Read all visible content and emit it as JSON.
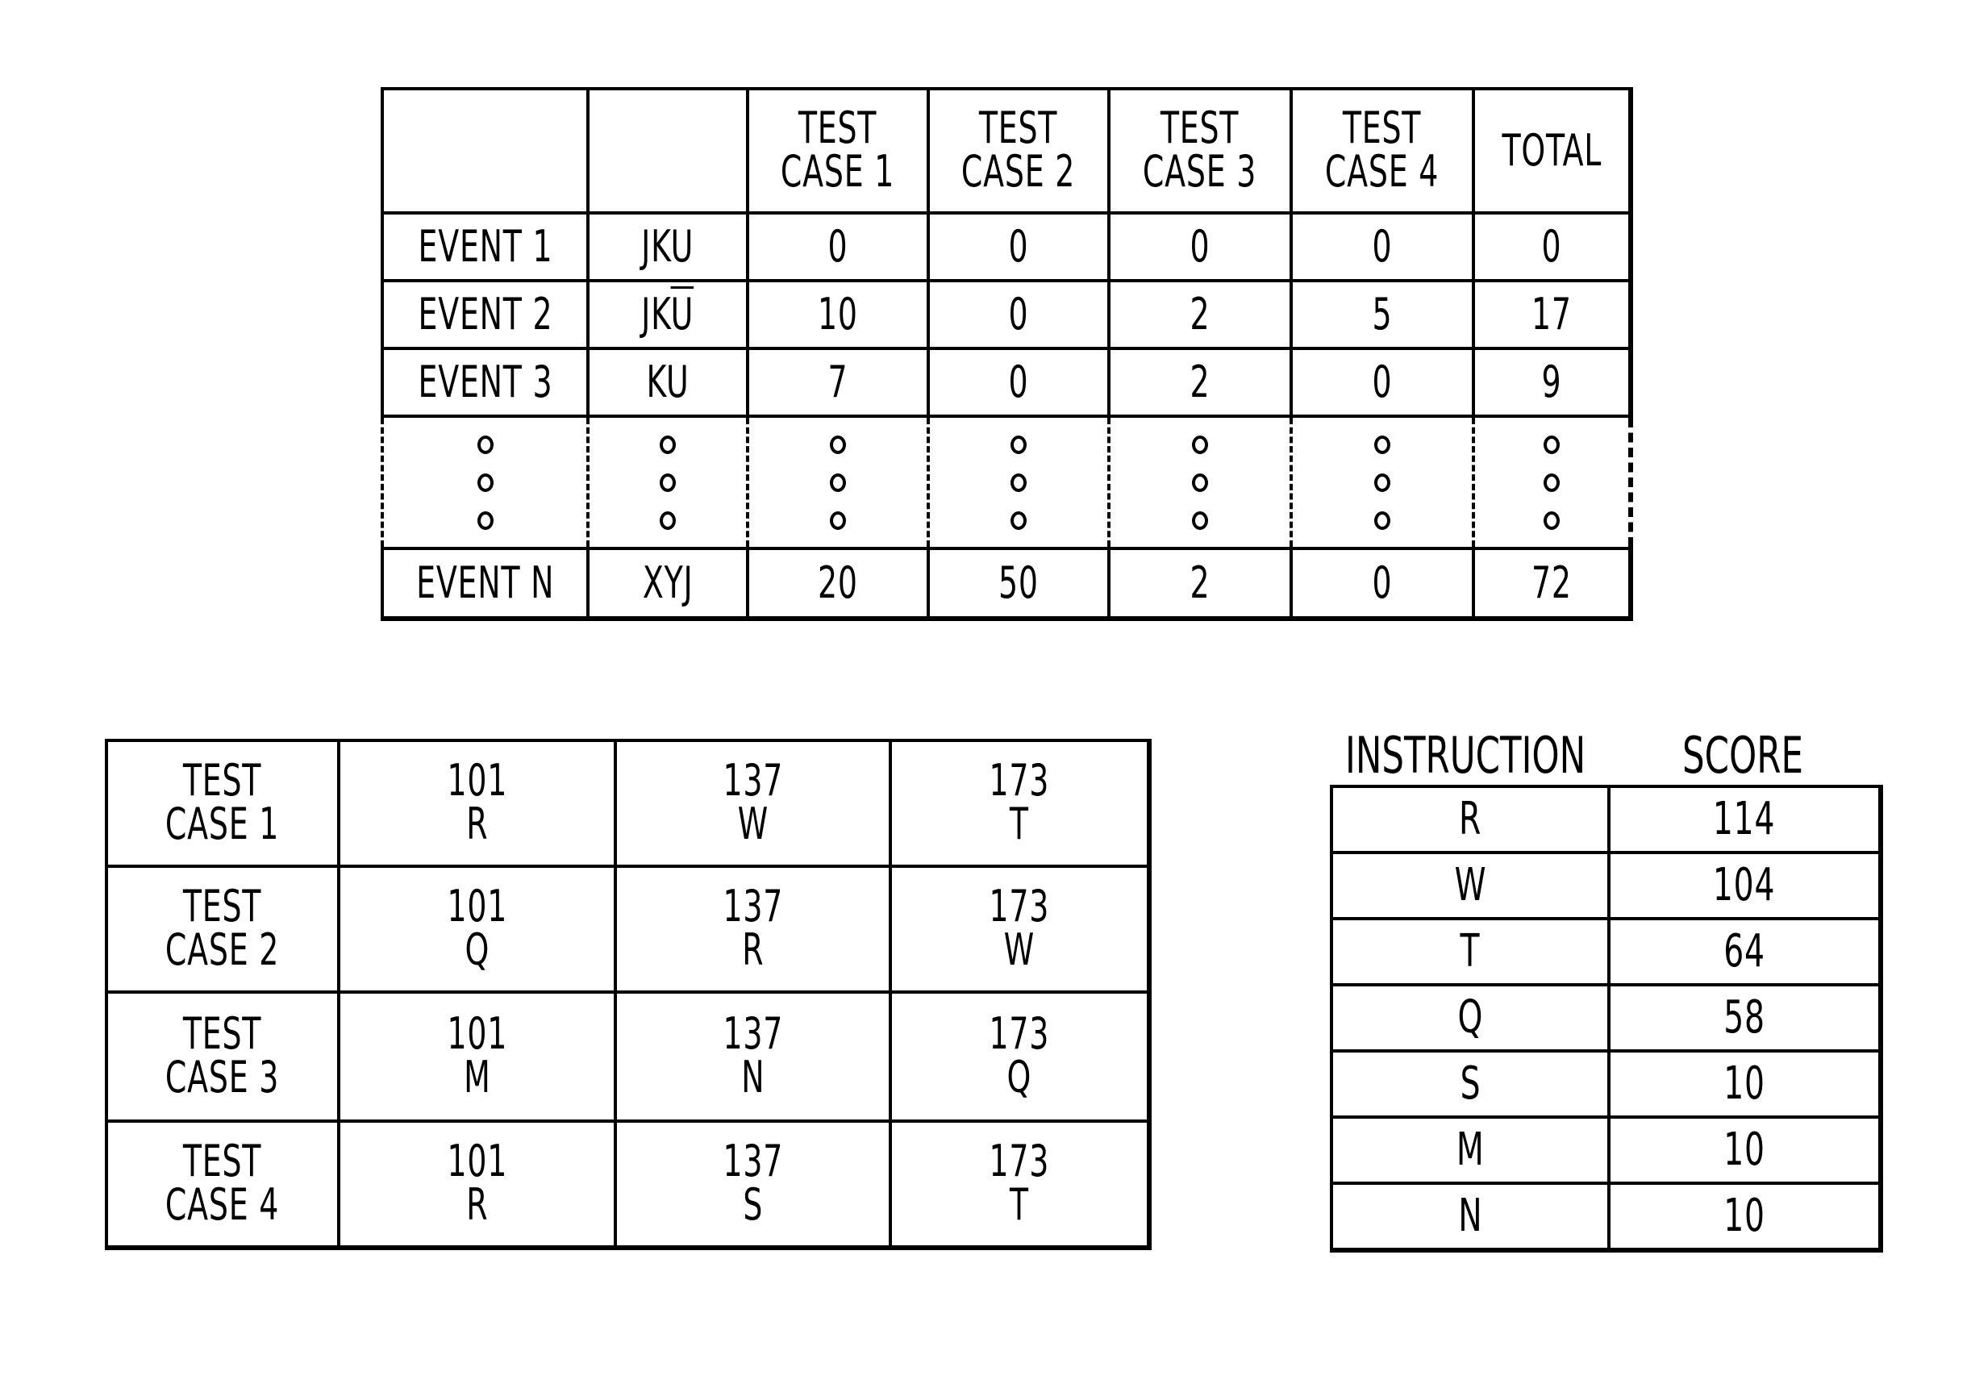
{
  "event_table": {
    "headers": [
      "",
      "",
      "TEST\nCASE  1",
      "TEST\nCASE  2",
      "TEST\nCASE  3",
      "TEST\nCASE  4",
      "TOTAL"
    ],
    "rows": [
      {
        "event": "EVENT  1",
        "code": "JKU",
        "code_overline": "",
        "values": [
          "0",
          "0",
          "0",
          "0"
        ],
        "total": "0"
      },
      {
        "event": "EVENT  2",
        "code": "JK",
        "code_overline": "U",
        "values": [
          "10",
          "0",
          "2",
          "5"
        ],
        "total": "17"
      },
      {
        "event": "EVENT  3",
        "code": "KU",
        "code_overline": "",
        "values": [
          "7",
          "0",
          "2",
          "0"
        ],
        "total": "9"
      }
    ],
    "ellipsis_marker": "ellipsis-dots",
    "last_row": {
      "event": "EVENT  N",
      "code": "XYJ",
      "values": [
        "20",
        "50",
        "2",
        "0"
      ],
      "total": "72"
    }
  },
  "test_case_table": {
    "rows": [
      {
        "label": "TEST\nCASE  1",
        "cells": [
          {
            "addr": "101",
            "instr": "R"
          },
          {
            "addr": "137",
            "instr": "W"
          },
          {
            "addr": "173",
            "instr": "T"
          }
        ]
      },
      {
        "label": "TEST\nCASE  2",
        "cells": [
          {
            "addr": "101",
            "instr": "Q"
          },
          {
            "addr": "137",
            "instr": "R"
          },
          {
            "addr": "173",
            "instr": "W"
          }
        ]
      },
      {
        "label": "TEST\nCASE  3",
        "cells": [
          {
            "addr": "101",
            "instr": "M"
          },
          {
            "addr": "137",
            "instr": "N"
          },
          {
            "addr": "173",
            "instr": "Q"
          }
        ]
      },
      {
        "label": "TEST\nCASE  4",
        "cells": [
          {
            "addr": "101",
            "instr": "R"
          },
          {
            "addr": "137",
            "instr": "S"
          },
          {
            "addr": "173",
            "instr": "T"
          }
        ]
      }
    ]
  },
  "score_table": {
    "headers": {
      "instruction": "INSTRUCTION",
      "score": "SCORE"
    },
    "rows": [
      {
        "instruction": "R",
        "score": "114"
      },
      {
        "instruction": "W",
        "score": "104"
      },
      {
        "instruction": "T",
        "score": "64"
      },
      {
        "instruction": "Q",
        "score": "58"
      },
      {
        "instruction": "S",
        "score": "10"
      },
      {
        "instruction": "M",
        "score": "10"
      },
      {
        "instruction": "N",
        "score": "10"
      }
    ]
  }
}
